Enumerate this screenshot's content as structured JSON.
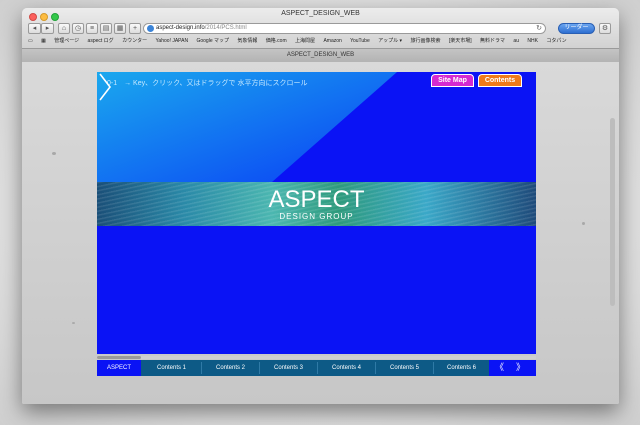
{
  "window": {
    "title": "ASPECT_DESIGN_WEB",
    "tab_title": "ASPECT_DESIGN_WEB"
  },
  "toolbar": {
    "url_host": "aspect-design.info",
    "url_path": "/2014/PCS.html",
    "reader_label": "リーダー",
    "reload_glyph": "↻"
  },
  "bookmarks": [
    "管理ページ",
    "aspect ログ",
    "カウンター",
    "Yahoo! JAPAN",
    "Google マップ",
    "気象情報",
    "価格.com",
    "上海問屋",
    "Amazon",
    "YouTube",
    "アップル ▾",
    "旅行画像検索",
    "[楽天市場]",
    "無料ドラマ",
    "au",
    "NHK",
    "コタパン"
  ],
  "page": {
    "instruction": "0-1　→ Key、クリック、又はドラッグで 水平方向にスクロール",
    "sitemap_label": "Site Map",
    "contents_label": "Contents",
    "brand": "ASPECT",
    "brand_sub": "DESIGN GROUP"
  },
  "nav": {
    "items": [
      "ASPECT",
      "Contents 1",
      "Contents 2",
      "Contents 3",
      "Contents 4",
      "Contents 5",
      "Contents 6"
    ],
    "prev_glyph": "《",
    "next_glyph": "》"
  },
  "colors": {
    "stage_blue": "#0a13f5",
    "nav_teal": "#0d5a86",
    "sitemap": "#d52ad0",
    "contents": "#f07a1a"
  }
}
